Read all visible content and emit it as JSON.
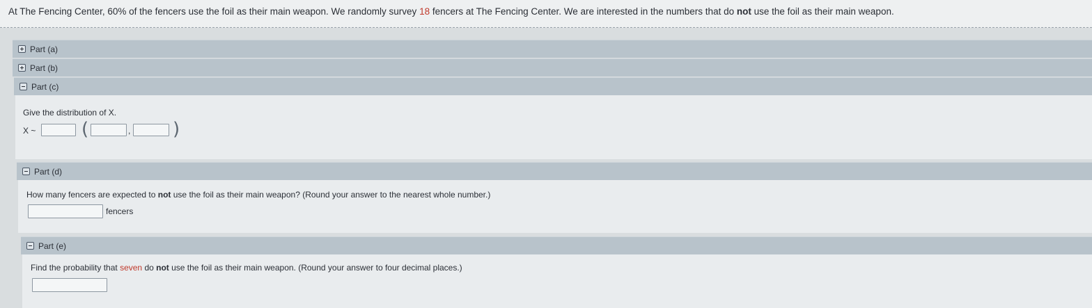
{
  "problem": {
    "prefix": "At The Fencing Center, 60% of the fencers use the foil as their main weapon. We randomly survey ",
    "count": "18",
    "middle": " fencers at The Fencing Center. We are interested in the numbers that do ",
    "emph": "not",
    "suffix": " use the foil as their main weapon."
  },
  "parts": {
    "a": {
      "label": "Part (a)"
    },
    "b": {
      "label": "Part (b)"
    },
    "c": {
      "label": "Part (c)",
      "prompt": "Give the distribution of X.",
      "lhs": "X ~",
      "separator": ","
    },
    "d": {
      "label": "Part (d)",
      "prompt_pre": "How many fencers are expected to ",
      "prompt_emph": "not",
      "prompt_post": " use the foil as their main weapon? (Round your answer to the nearest whole number.)",
      "unit": "fencers"
    },
    "e": {
      "label": "Part (e)",
      "prompt_pre": "Find the probability that ",
      "prompt_red": "seven",
      "prompt_mid": " do ",
      "prompt_emph": "not",
      "prompt_post": " use the foil as their main weapon. (Round your answer to four decimal places.)"
    }
  },
  "inputs": {
    "dist_name": "",
    "param1": "",
    "param2": "",
    "expected": "",
    "probability": ""
  }
}
